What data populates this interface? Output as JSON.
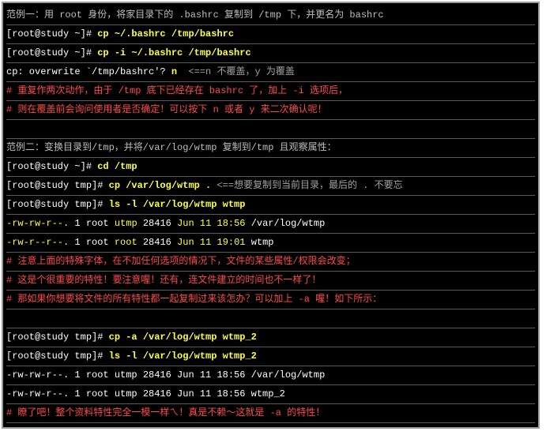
{
  "lines": [
    {
      "segments": [
        {
          "t": "范例一：用 root 身份，将家目录下的 .bashrc 复制到 /tmp 下，并更名为 bashrc",
          "c": "gray"
        }
      ]
    },
    {
      "segments": [
        {
          "t": "[root@study ~]# ",
          "c": "white"
        },
        {
          "t": "cp ~/.bashrc /tmp/bashrc",
          "c": "yellow"
        }
      ]
    },
    {
      "segments": [
        {
          "t": "[root@study ~]# ",
          "c": "white"
        },
        {
          "t": "cp -i ~/.bashrc /tmp/bashrc",
          "c": "yellow"
        }
      ]
    },
    {
      "segments": [
        {
          "t": "cp: overwrite `/tmp/bashrc'? ",
          "c": "white"
        },
        {
          "t": "n",
          "c": "yellow"
        },
        {
          "t": "  <==n 不覆盖，y 为覆盖",
          "c": "dimgray"
        }
      ]
    },
    {
      "segments": [
        {
          "t": "# 重复作两次动作，由于 /tmp 底下已经存在 bashrc 了，加上 -i 选项后，",
          "c": "red"
        }
      ]
    },
    {
      "segments": [
        {
          "t": "# 则在覆盖前会询问使用者是否确定！可以按下 n 或者 y 来二次确认呢！",
          "c": "red"
        }
      ]
    },
    {
      "segments": [
        {
          "t": "",
          "c": "white"
        }
      ]
    },
    {
      "segments": [
        {
          "t": "范例二：变换目录到/tmp，并将/var/log/wtmp 复制到/tmp 且观察属性：",
          "c": "gray"
        }
      ]
    },
    {
      "segments": [
        {
          "t": "[root@study ~]# ",
          "c": "white"
        },
        {
          "t": "cd /tmp",
          "c": "yellow"
        }
      ]
    },
    {
      "segments": [
        {
          "t": "[root@study tmp]# ",
          "c": "white"
        },
        {
          "t": "cp /var/log/wtmp .",
          "c": "yellow"
        },
        {
          "t": " <==想要复制到当前目录，最后的 . 不要忘",
          "c": "dimgray"
        }
      ]
    },
    {
      "segments": [
        {
          "t": "[root@study tmp]# ",
          "c": "white"
        },
        {
          "t": "ls -l /var/log/wtmp wtmp",
          "c": "yellow"
        }
      ]
    },
    {
      "segments": [
        {
          "t": "-rw-rw-r--. ",
          "c": "utmpy"
        },
        {
          "t": "1 root ",
          "c": "white"
        },
        {
          "t": "utmp",
          "c": "utmpy"
        },
        {
          "t": " 28416 ",
          "c": "white"
        },
        {
          "t": "Jun 11 18:56",
          "c": "utmpy"
        },
        {
          "t": " /var/log/wtmp",
          "c": "white"
        }
      ]
    },
    {
      "segments": [
        {
          "t": "-rw-r--r--. ",
          "c": "utmpy"
        },
        {
          "t": "1 root ",
          "c": "white"
        },
        {
          "t": "root",
          "c": "utmpy"
        },
        {
          "t": " 28416 ",
          "c": "white"
        },
        {
          "t": "Jun 11 19:01",
          "c": "utmpy"
        },
        {
          "t": " wtmp",
          "c": "white"
        }
      ]
    },
    {
      "segments": [
        {
          "t": "# 注意上面的特殊字体，在不加任何选项的情况下，文件的某些属性/权限会改变；",
          "c": "red"
        }
      ]
    },
    {
      "segments": [
        {
          "t": "# 这是个很重要的特性！要注意喔！还有，连文件建立的时间也不一样了！",
          "c": "red"
        }
      ]
    },
    {
      "segments": [
        {
          "t": "# 那如果你想要将文件的所有特性都一起复制过来该怎办？可以加上 -a 喔！如下所示：",
          "c": "red"
        }
      ]
    },
    {
      "segments": [
        {
          "t": "",
          "c": "white"
        }
      ]
    },
    {
      "segments": [
        {
          "t": "[root@study tmp]# ",
          "c": "white"
        },
        {
          "t": "cp -a /var/log/wtmp wtmp_2",
          "c": "yellow"
        }
      ]
    },
    {
      "segments": [
        {
          "t": "[root@study tmp]# ",
          "c": "white"
        },
        {
          "t": "ls -l /var/log/wtmp wtmp_2",
          "c": "yellow"
        }
      ]
    },
    {
      "segments": [
        {
          "t": "-rw-rw-r--. 1 root utmp 28416 Jun 11 18:56 /var/log/wtmp",
          "c": "white"
        }
      ]
    },
    {
      "segments": [
        {
          "t": "-rw-rw-r--. 1 root utmp 28416 Jun 11 18:56 wtmp_2",
          "c": "white"
        }
      ]
    },
    {
      "segments": [
        {
          "t": "# 瞭了吧！整个资料特性完全一模一样ㄟ！真是不赖～这就是 -a 的特性！",
          "c": "red"
        }
      ]
    }
  ]
}
